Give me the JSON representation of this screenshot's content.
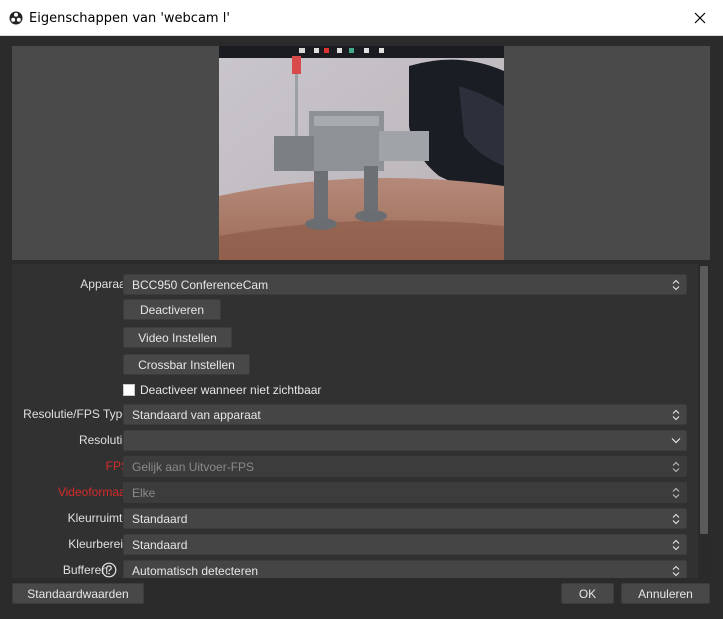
{
  "window": {
    "title": "Eigenschappen van 'webcam l'",
    "app_icon": "obs-icon",
    "close_icon": "close-icon"
  },
  "preview": {
    "description_icon": "webcam-preview"
  },
  "properties": {
    "device": {
      "label": "Apparaat",
      "value": "BCC950 ConferenceCam"
    },
    "buttons": {
      "deactivate": "Deactiveren",
      "video_settings": "Video Instellen",
      "crossbar_settings": "Crossbar Instellen"
    },
    "deactivate_when_hidden": {
      "label": "Deactiveer wanneer niet zichtbaar",
      "checked": false
    },
    "res_fps_type": {
      "label": "Resolutie/FPS Type",
      "value": "Standaard van apparaat"
    },
    "resolution": {
      "label": "Resolutie",
      "value": ""
    },
    "fps": {
      "label": "FPS",
      "value": "Gelijk aan Uitvoer-FPS"
    },
    "video_format": {
      "label": "Videoformaat",
      "value": "Elke"
    },
    "color_space": {
      "label": "Kleurruimte",
      "value": "Standaard"
    },
    "color_range": {
      "label": "Kleurbereik",
      "value": "Standaard"
    },
    "buffering": {
      "label": "Bufferen",
      "value": "Automatisch detecteren"
    }
  },
  "footer": {
    "defaults": "Standaardwaarden",
    "ok": "OK",
    "cancel": "Annuleren"
  },
  "colors": {
    "background": "#2b2b2b",
    "panel": "#313131",
    "field": "#454545",
    "warning_label": "#d62b2b"
  }
}
